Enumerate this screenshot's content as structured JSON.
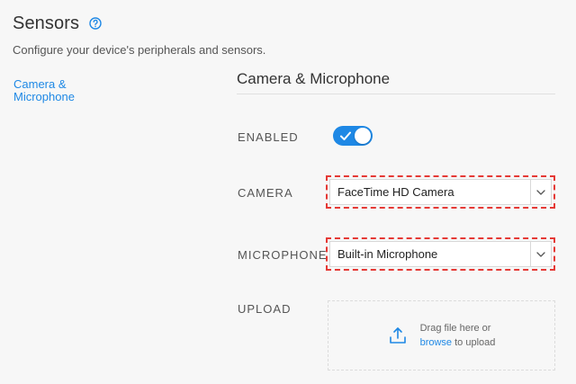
{
  "header": {
    "title": "Sensors",
    "subtitle": "Configure your device's peripherals and sensors."
  },
  "sidebar": {
    "items": [
      {
        "label": "Camera & Microphone",
        "active": true
      }
    ]
  },
  "section": {
    "title": "Camera & Microphone"
  },
  "fields": {
    "enabled": {
      "label": "ENABLED",
      "value": true
    },
    "camera": {
      "label": "CAMERA",
      "value": "FaceTime HD Camera"
    },
    "microphone": {
      "label": "MICROPHONE",
      "value": "Built-in Microphone"
    },
    "upload": {
      "label": "UPLOAD",
      "line1": "Drag file here or",
      "link": "browse",
      "line2_suffix": " to upload"
    }
  },
  "icons": {
    "help": "help-circle-icon",
    "toggle_check": "check-icon",
    "caret": "chevron-down-icon",
    "upload": "upload-icon"
  },
  "colors": {
    "accent": "#1e88e5",
    "highlight": "#e53935",
    "background": "#f7f7f7"
  }
}
